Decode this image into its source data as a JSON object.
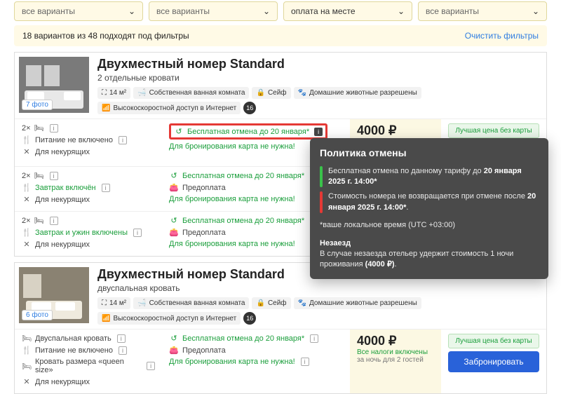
{
  "filters": {
    "dd1": "все варианты",
    "dd2": "все варианты",
    "dd3": "оплата на месте",
    "dd4": "все варианты"
  },
  "result_bar": {
    "text": "18 вариантов из 48 подходят под фильтры",
    "clear": "Очистить фильтры"
  },
  "room1": {
    "title": "Двухместный номер Standard",
    "subtitle": "2 отдельные кровати",
    "photos": "7 фото",
    "amen": {
      "area": "14 м²",
      "bath": "Собственная ванная комната",
      "safe": "Сейф",
      "pets": "Домашние животные разрешены",
      "wifi": "Высокоскоростной доступ в Интернет",
      "age": "16"
    }
  },
  "rates": {
    "beds": "2×",
    "r1": {
      "meal": "Питание не включено",
      "smoke": "Для некурящих",
      "cancel": "Бесплатная отмена до 20 января*",
      "card": "Для бронирования карта не нужна!"
    },
    "r2": {
      "meal": "Завтрак включён",
      "smoke": "Для некурящих",
      "cancel": "Бесплатная отмена до 20 января*",
      "prepay": "Предоплата",
      "card": "Для бронирования карта не нужна!"
    },
    "r3": {
      "meal": "Завтрак и ужин включены",
      "smoke": "Для некурящих",
      "cancel": "Бесплатная отмена до 20 января*",
      "prepay": "Предоплата",
      "card": "Для бронирования карта не нужна!"
    }
  },
  "price": {
    "amount": "4000 ₽",
    "tax": "Все налоги включены",
    "night": "за ночь для 2 гостей",
    "best": "Лучшая цена без карты",
    "book": "Забронировать"
  },
  "room2": {
    "title": "Двухместный номер Standard",
    "subtitle": "двуспальная кровать",
    "photos": "6 фото",
    "r": {
      "bed": "Двуспальная кровать",
      "meal": "Питание не включено",
      "queen": "Кровать размера «queen size»",
      "smoke": "Для некурящих",
      "cancel": "Бесплатная отмена до 20 января*",
      "prepay": "Предоплата",
      "card": "Для бронирования карта не нужна!"
    }
  },
  "tooltip": {
    "title": "Политика отмены",
    "line1a": "Бесплатная отмена по данному тарифу до ",
    "line1b": "20 января 2025 г. 14:00*",
    "line2a": "Стоимость номера не возвращается при отмене после ",
    "line2b": "20 января 2025 г. 14:00*",
    "tz": "*ваше локальное время (UTC +03:00)",
    "noshow_h": "Незаезд",
    "noshow_t1": "В случае незаезда отельер удержит стоимость 1 ночи проживания ",
    "noshow_t2": "(4000 ₽)",
    "noshow_t3": "."
  }
}
